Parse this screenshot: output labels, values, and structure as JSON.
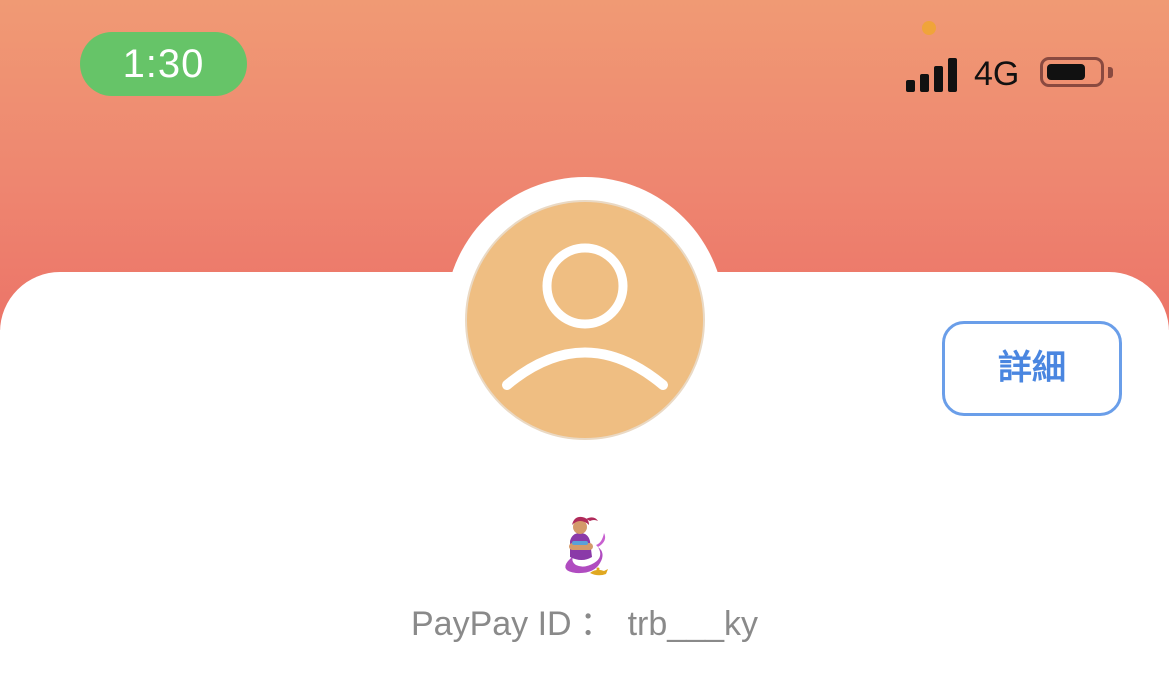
{
  "status_bar": {
    "time": "1:30",
    "network": "4G",
    "signal_bars": 4,
    "battery_level": 0.75,
    "time_pill_color": "#66c468",
    "camera_dot_color": "#f0a43a"
  },
  "header": {
    "gradient_top_color": "#f09a74",
    "gradient_bottom_color": "#ec7468"
  },
  "profile": {
    "avatar_icon": "user-silhouette-icon",
    "avatar_color": "#efbe82",
    "detail_button_label": "詳細",
    "detail_button_color": "#4a86e0",
    "emoji_icon": "genie-emoji-icon",
    "paypay_id_label": "PayPay ID",
    "paypay_id_separator": "：",
    "paypay_id_value": "trb___ky"
  }
}
